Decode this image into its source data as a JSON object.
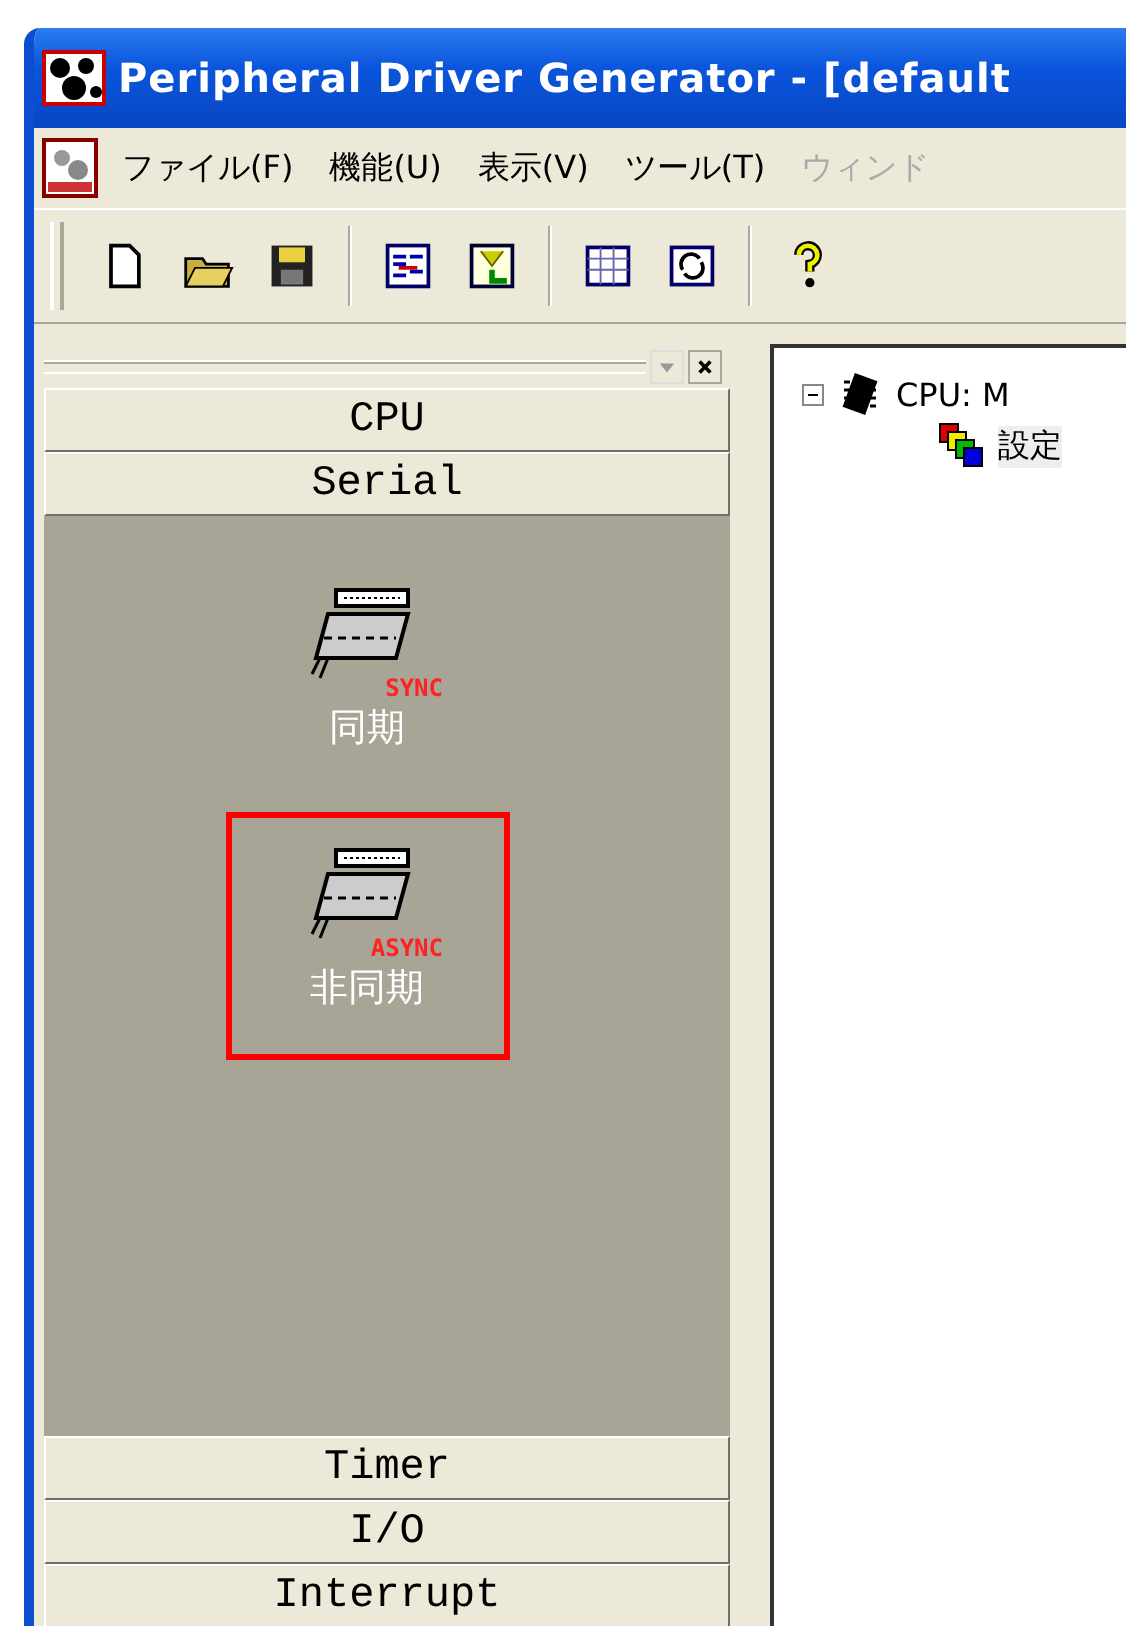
{
  "window": {
    "title": "Peripheral Driver Generator - [default"
  },
  "menu": [
    {
      "label": "ファイル(F)",
      "disabled": false
    },
    {
      "label": "機能(U)",
      "disabled": false
    },
    {
      "label": "表示(V)",
      "disabled": false
    },
    {
      "label": "ツール(T)",
      "disabled": false
    },
    {
      "label": "ウィンド",
      "disabled": true
    }
  ],
  "palette": {
    "top_categories": [
      {
        "label": "CPU"
      },
      {
        "label": "Serial"
      }
    ],
    "items": [
      {
        "label": "同期",
        "badge": "SYNC",
        "selected": false
      },
      {
        "label": "非同期",
        "badge": "ASYNC",
        "selected": true
      }
    ],
    "bottom_categories": [
      {
        "label": "Timer"
      },
      {
        "label": "I/O"
      },
      {
        "label": "Interrupt"
      }
    ]
  },
  "tree": [
    {
      "label": "CPU: M",
      "kind": "chip",
      "expanded": true,
      "children": [
        {
          "label": "設定",
          "kind": "blocks"
        }
      ]
    }
  ]
}
